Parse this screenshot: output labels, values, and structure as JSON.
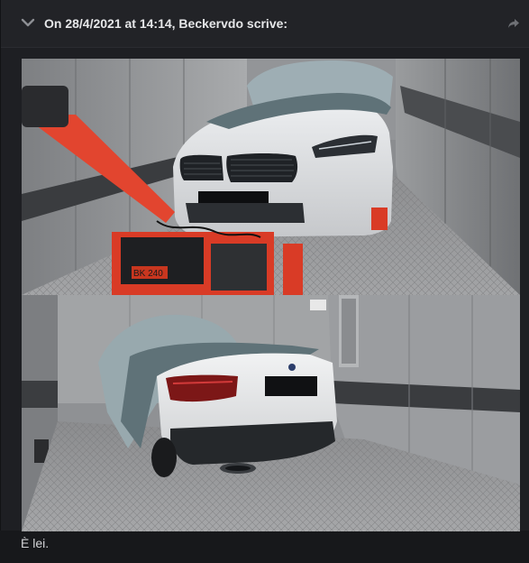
{
  "quote": {
    "title": "On 28/4/2021 at 14:14, Beckervdo scrive:",
    "collapse_icon": "chevron-down-icon",
    "share_icon": "share-arrow-icon"
  },
  "photos": [
    {
      "subject": "car-front-in-elevator",
      "badge": "BK 240"
    },
    {
      "subject": "car-rear-in-elevator"
    }
  ],
  "post": {
    "text": "È lei."
  },
  "colors": {
    "page_bg": "#17181b",
    "quote_bg": "#1e1f23",
    "quote_header_bg": "#222327",
    "text": "#d4d5d8"
  }
}
